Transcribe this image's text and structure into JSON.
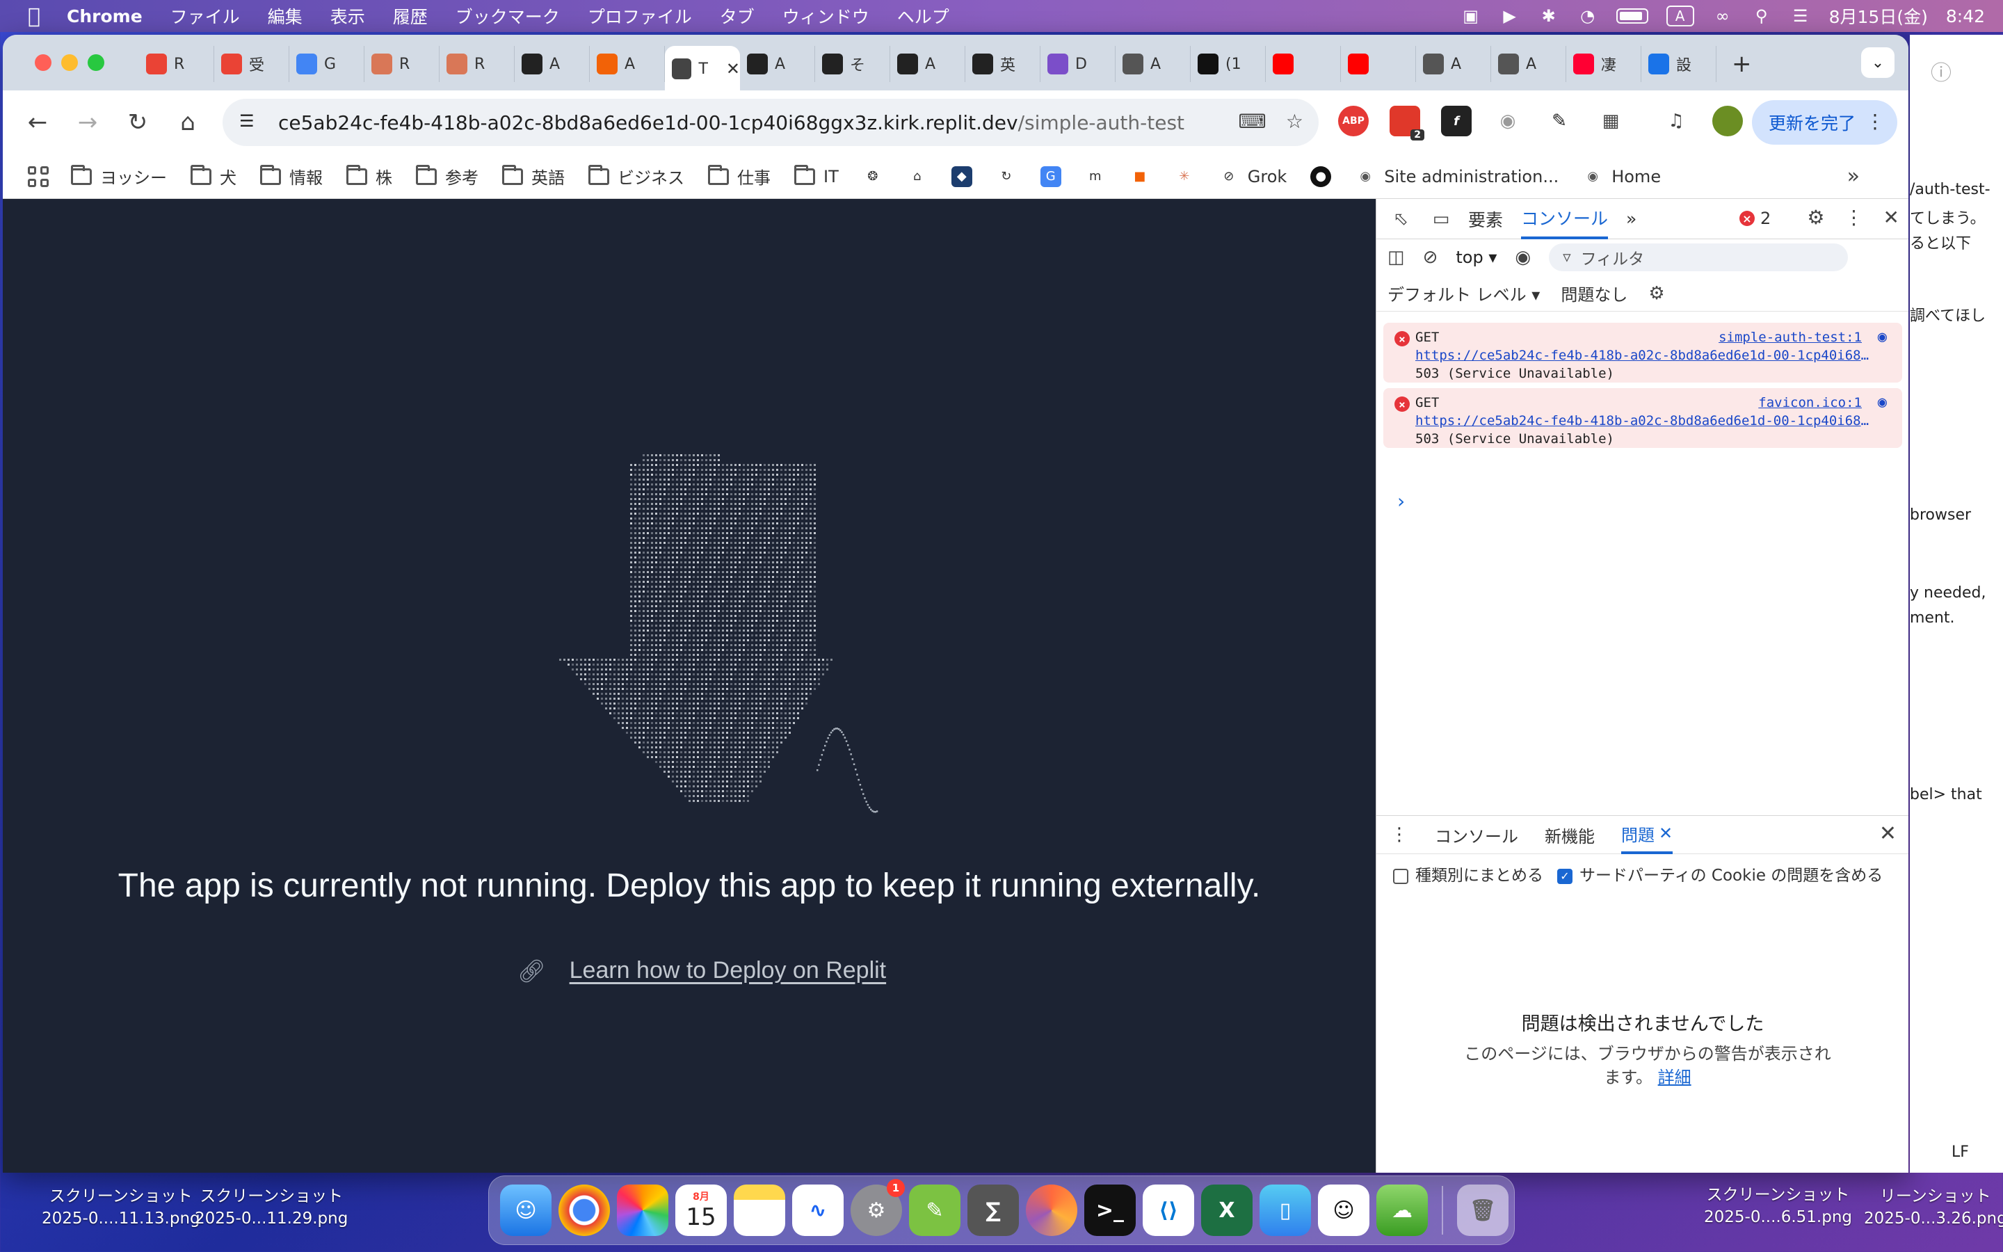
{
  "menubar": {
    "app_name": "Chrome",
    "menus": [
      "ファイル",
      "編集",
      "表示",
      "履歴",
      "ブックマーク",
      "プロファイル",
      "タブ",
      "ウィンドウ",
      "ヘルプ"
    ],
    "date": "8月15日(金)",
    "time": "8:42",
    "input_mode": "A"
  },
  "tabs": [
    {
      "icon": "gmail-icon",
      "title": "R",
      "color": "#ea4335"
    },
    {
      "icon": "gmail-icon",
      "title": "受",
      "color": "#ea4335"
    },
    {
      "icon": "calendar-icon",
      "title": "G",
      "color": "#4285f4"
    },
    {
      "icon": "claude-icon",
      "title": "R",
      "color": "#d97757"
    },
    {
      "icon": "claude-icon",
      "title": "R",
      "color": "#d97757"
    },
    {
      "icon": "app-icon",
      "title": "A",
      "color": "#222222"
    },
    {
      "icon": "replit-icon",
      "title": "A",
      "color": "#f26207"
    },
    {
      "icon": "page-icon",
      "title": "T",
      "color": "#444444",
      "active": true
    },
    {
      "icon": "openai-icon",
      "title": "A",
      "color": "#222222"
    },
    {
      "icon": "openai-icon",
      "title": "そ",
      "color": "#222222"
    },
    {
      "icon": "notion-icon",
      "title": "A",
      "color": "#222222"
    },
    {
      "icon": "notion-icon",
      "title": "英",
      "color": "#222222"
    },
    {
      "icon": "app-icon",
      "title": "D",
      "color": "#7b4ec9"
    },
    {
      "icon": "globe-icon",
      "title": "A",
      "color": "#555555"
    },
    {
      "icon": "x-icon",
      "title": "(1",
      "color": "#111111"
    },
    {
      "icon": "youtube-icon",
      "title": "",
      "color": "#ff0000"
    },
    {
      "icon": "youtube-icon",
      "title": "",
      "color": "#ff0000"
    },
    {
      "icon": "globe-icon",
      "title": "A",
      "color": "#555555"
    },
    {
      "icon": "globe-icon",
      "title": "A",
      "color": "#555555"
    },
    {
      "icon": "yahoo-icon",
      "title": "凄",
      "color": "#ff0033"
    },
    {
      "icon": "gear-icon",
      "title": "設",
      "color": "#1a73e8"
    }
  ],
  "active_tab_title": "T",
  "omnibox": {
    "host": "ce5ab24c-fe4b-418b-a02c-8bd8a6ed6e1d-00-1cp40i68ggx3z.kirk.replit.dev",
    "path": "/simple-auth-test"
  },
  "extensions": {
    "abp_label": "ABP",
    "badge_count": "2"
  },
  "update_button": "更新を完了",
  "bookmarks": [
    {
      "type": "folder",
      "label": "ヨッシー"
    },
    {
      "type": "folder",
      "label": "犬"
    },
    {
      "type": "folder",
      "label": "情報"
    },
    {
      "type": "folder",
      "label": "株"
    },
    {
      "type": "folder",
      "label": "参考"
    },
    {
      "type": "folder",
      "label": "英語"
    },
    {
      "type": "folder",
      "label": "ビジネス"
    },
    {
      "type": "folder",
      "label": "仕事"
    },
    {
      "type": "folder",
      "label": "IT"
    }
  ],
  "bookmark_named": {
    "grok": "Grok",
    "site_admin": "Site administration...",
    "home": "Home"
  },
  "page": {
    "message": "The app is currently not running. Deploy this app to keep it running externally.",
    "link": "Learn how to Deploy on Replit",
    "background_color": "#1c2333"
  },
  "devtools": {
    "tabs": [
      "要素",
      "コンソール"
    ],
    "active_tab": "コンソール",
    "error_count": "2",
    "context": "top",
    "filter_placeholder": "フィルタ",
    "level": "デフォルト レベル",
    "issues": "問題なし",
    "logs": [
      {
        "method": "GET",
        "source": "simple-auth-test:1",
        "url": "https://ce5ab24c-fe4b-418b-a02c-8bd8a6ed6e1d-00-1cp40i68g…",
        "status": "503 (Service Unavailable)"
      },
      {
        "method": "GET",
        "source": "favicon.ico:1",
        "url": "https://ce5ab24c-fe4b-418b-a02c-8bd8a6ed6e1d-00-1cp40i68g…",
        "status": "503 (Service Unavailable)"
      }
    ],
    "drawer_tabs": [
      "コンソール",
      "新機能",
      "問題"
    ],
    "drawer_active": "問題",
    "group_by_kind": "種類別にまとめる",
    "include_third_party": "サードパーティの Cookie の問題を含める",
    "no_issues_title": "問題は検出されませんでした",
    "no_issues_desc": "このページには、ブラウザからの警告が表示されます。",
    "detail_link": "詳細"
  },
  "background_window": {
    "lines": [
      "/auth-test-",
      "てしまう。",
      "ると以下",
      "調べてほし",
      "browser",
      "y needed,",
      "ment.",
      "bel> that"
    ],
    "status_lf": "LF"
  },
  "desktop_files": [
    {
      "name": "スクリーンショット",
      "date": "2025-0....11.13.png"
    },
    {
      "name": "スクリーンショット",
      "date": "2025-0...11.29.png"
    },
    {
      "name": "スクリーンショット",
      "date": "2025-0....6.51.png"
    },
    {
      "name": "リーンショット",
      "date": "2025-0...3.26.png"
    }
  ],
  "dock": {
    "calendar_month": "8月",
    "calendar_day": "15",
    "settings_badge": "1"
  }
}
